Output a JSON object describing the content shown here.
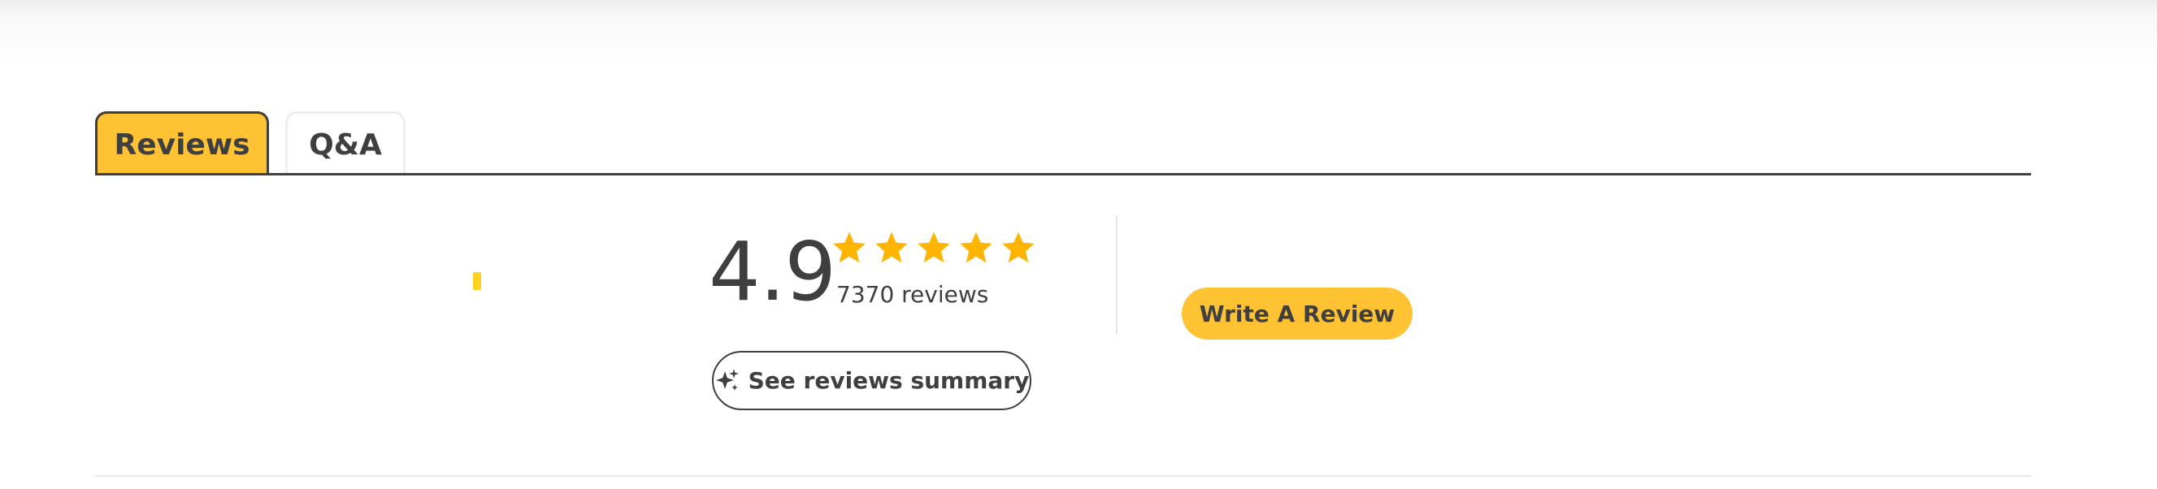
{
  "tabs": [
    {
      "label": "Reviews",
      "active": true
    },
    {
      "label": "Q&A",
      "active": false
    }
  ],
  "rating": {
    "value": "4.9",
    "stars_filled": 5,
    "stars_total": 5,
    "star_color": "#ffb400",
    "review_count_text": "7370 reviews"
  },
  "actions": {
    "summary_button_label": "See reviews summary",
    "summary_icon": "sparkle-icon",
    "write_review_label": "Write A Review"
  },
  "colors": {
    "accent": "#ffc233",
    "text": "#3f3f3f",
    "loading_mark": "#ffd21f"
  }
}
